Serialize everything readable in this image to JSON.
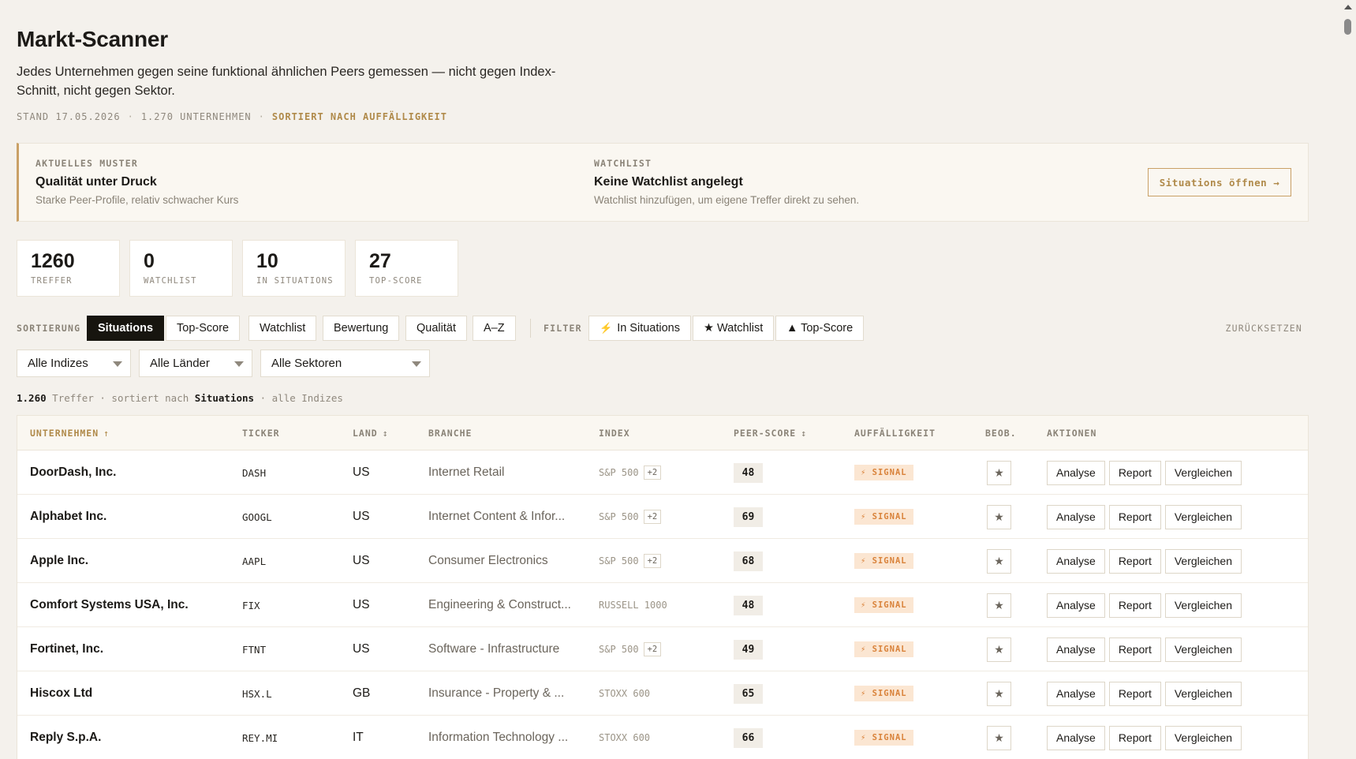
{
  "header": {
    "title": "Markt-Scanner",
    "subtitle": "Jedes Unternehmen gegen seine funktional ähnlichen Peers gemessen — nicht gegen Index-Schnitt, nicht gegen Sektor.",
    "meta_date": "STAND 17.05.2026",
    "meta_count": "1.270 UNTERNEHMEN",
    "meta_sort": "SORTIERT NACH AUFFÄLLIGKEIT",
    "meta_sep": "·"
  },
  "banner": {
    "pattern_label": "AKTUELLES MUSTER",
    "pattern_title": "Qualität unter Druck",
    "pattern_sub": "Starke Peer-Profile, relativ schwacher Kurs",
    "watch_label": "WATCHLIST",
    "watch_title": "Keine Watchlist angelegt",
    "watch_sub": "Watchlist hinzufügen, um eigene Treffer direkt zu sehen.",
    "open_button": "Situations öffnen →"
  },
  "stats": [
    {
      "num": "1260",
      "label": "TREFFER"
    },
    {
      "num": "0",
      "label": "WATCHLIST"
    },
    {
      "num": "10",
      "label": "IN SITUATIONS"
    },
    {
      "num": "27",
      "label": "TOP-SCORE"
    }
  ],
  "toolbar": {
    "sort_label": "SORTIERUNG",
    "sort_options": [
      "Situations",
      "Top-Score",
      "Watchlist",
      "Bewertung",
      "Qualität",
      "A–Z"
    ],
    "filter_label": "FILTER",
    "filters": [
      "In Situations",
      "★ Watchlist",
      "▲ Top-Score"
    ],
    "reset": "ZURÜCKSETZEN"
  },
  "selects": [
    "Alle Indizes",
    "Alle Länder",
    "Alle Sektoren"
  ],
  "count_line": {
    "count": "1.260",
    "text1": "Treffer · sortiert nach",
    "sort": "Situations",
    "text2": "· alle Indizes"
  },
  "table": {
    "headers": {
      "name": "UNTERNEHMEN",
      "ticker": "TICKER",
      "land": "LAND",
      "branche": "BRANCHE",
      "index": "INDEX",
      "score": "PEER-SCORE",
      "signal": "AUFFÄLLIGKEIT",
      "watch": "BEOB.",
      "actions": "AKTIONEN"
    },
    "sort_up_icon": "↑",
    "sort_both_icon": "↕",
    "signal_icon": "⚡",
    "signal_text": "SIGNAL",
    "star_icon": "★",
    "action_labels": [
      "Analyse",
      "Report",
      "Vergleichen"
    ],
    "rows": [
      {
        "name": "DoorDash, Inc.",
        "ticker": "DASH",
        "land": "US",
        "branche": "Internet Retail",
        "index": "S&P 500",
        "plus": "+2",
        "score": "48"
      },
      {
        "name": "Alphabet Inc.",
        "ticker": "GOOGL",
        "land": "US",
        "branche": "Internet Content & Infor...",
        "index": "S&P 500",
        "plus": "+2",
        "score": "69"
      },
      {
        "name": "Apple Inc.",
        "ticker": "AAPL",
        "land": "US",
        "branche": "Consumer Electronics",
        "index": "S&P 500",
        "plus": "+2",
        "score": "68"
      },
      {
        "name": "Comfort Systems USA, Inc.",
        "ticker": "FIX",
        "land": "US",
        "branche": "Engineering & Construct...",
        "index": "RUSSELL 1000",
        "plus": "",
        "score": "48"
      },
      {
        "name": "Fortinet, Inc.",
        "ticker": "FTNT",
        "land": "US",
        "branche": "Software - Infrastructure",
        "index": "S&P 500",
        "plus": "+2",
        "score": "49"
      },
      {
        "name": "Hiscox Ltd",
        "ticker": "HSX.L",
        "land": "GB",
        "branche": "Insurance - Property & ...",
        "index": "STOXX 600",
        "plus": "",
        "score": "65"
      },
      {
        "name": "Reply S.p.A.",
        "ticker": "REY.MI",
        "land": "IT",
        "branche": "Information Technology ...",
        "index": "STOXX 600",
        "plus": "",
        "score": "66"
      }
    ]
  }
}
